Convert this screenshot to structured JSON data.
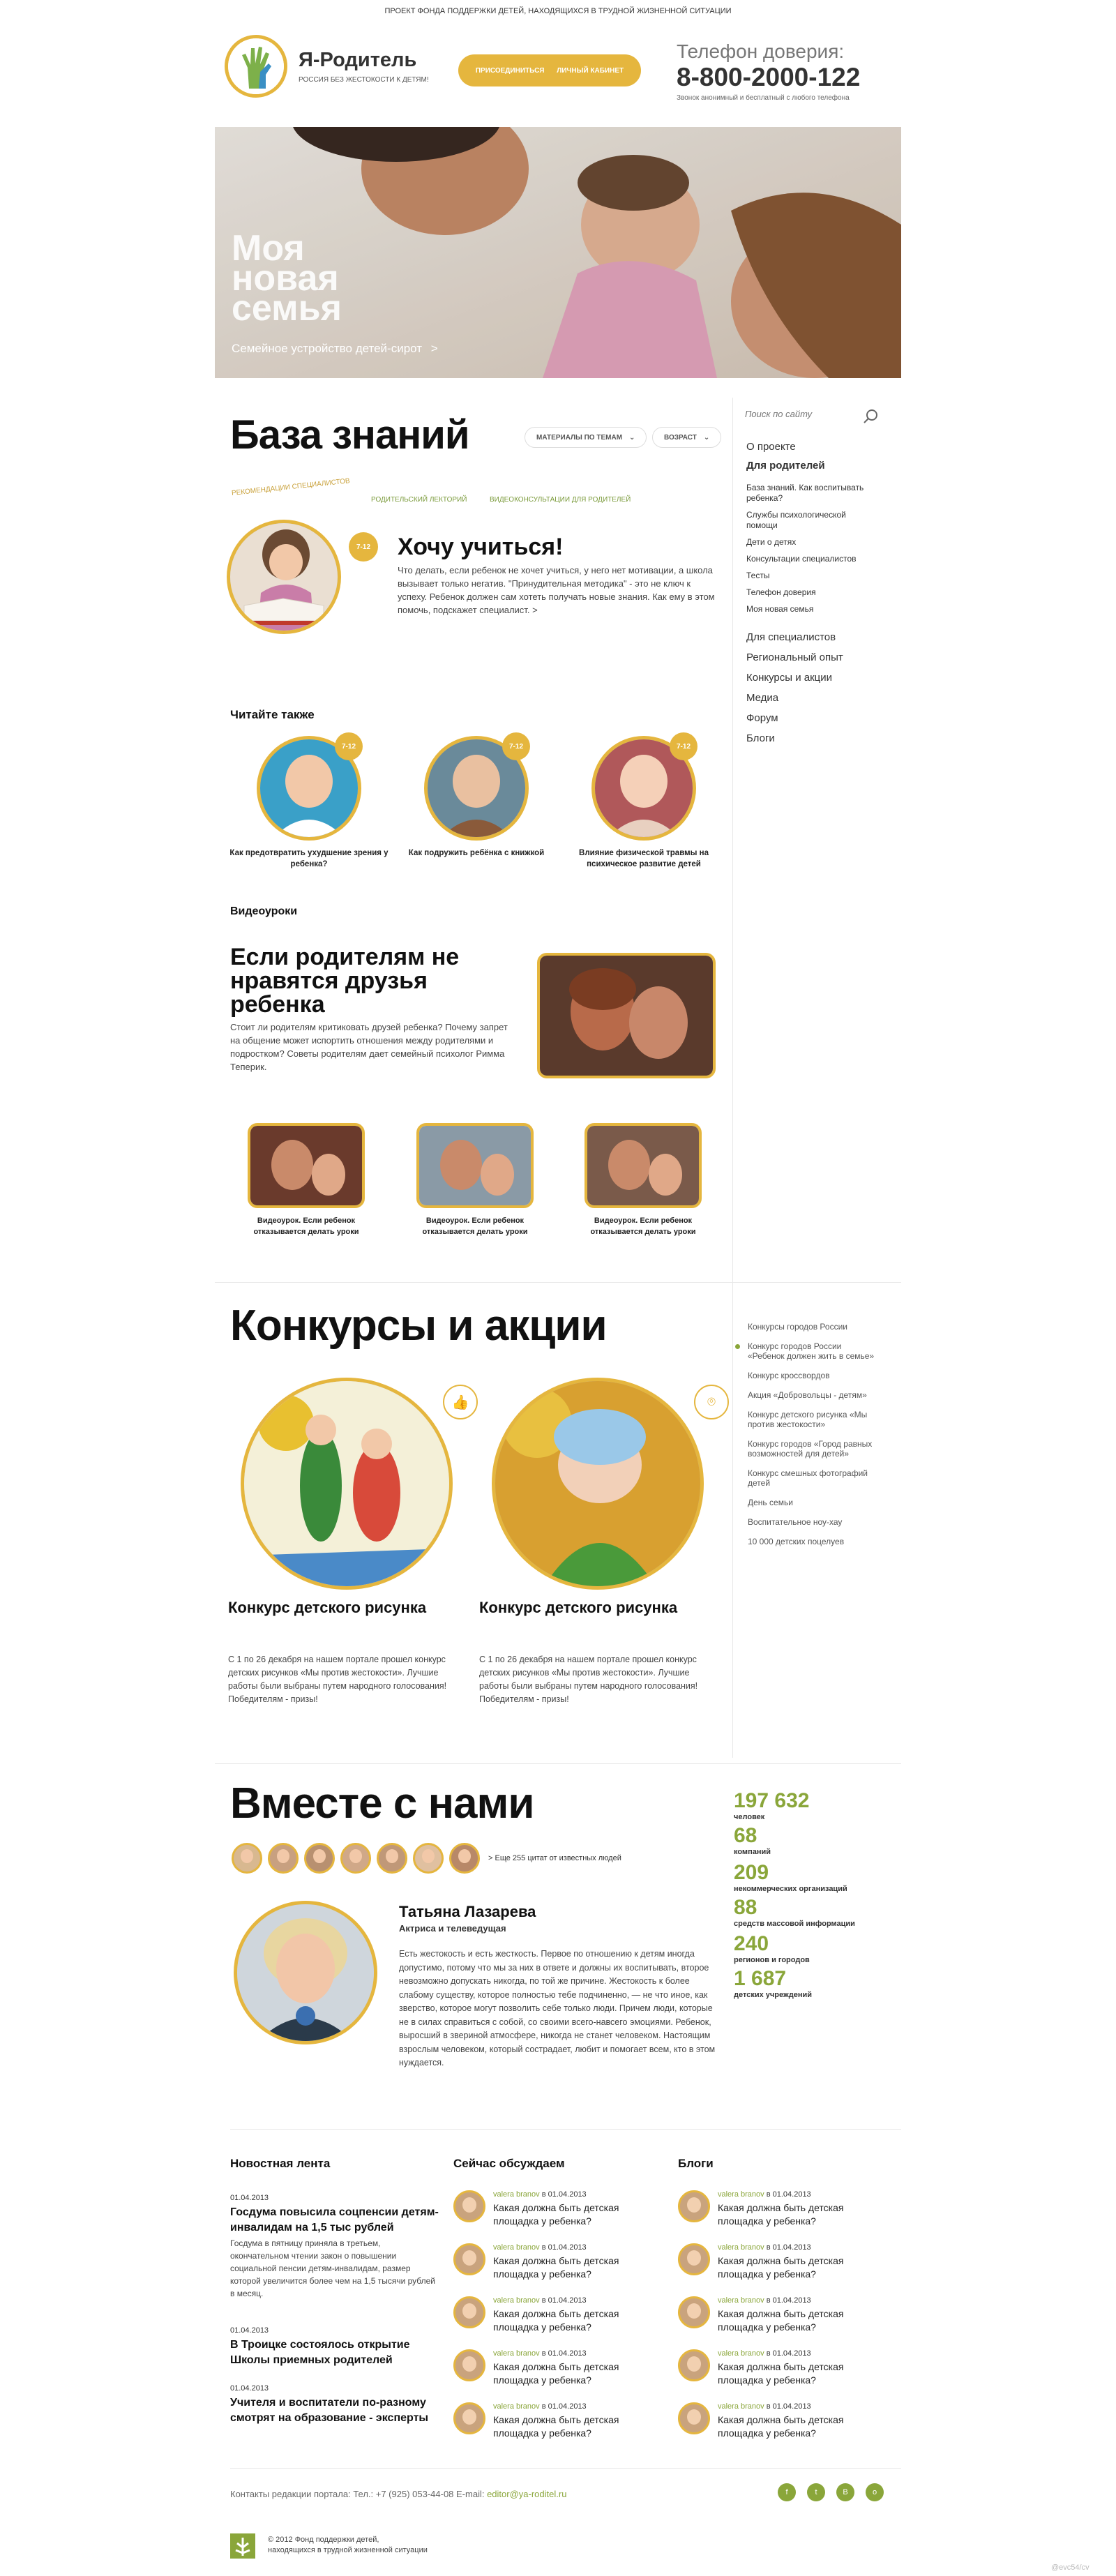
{
  "header": {
    "top_text": "ПРОЕКТ ФОНДА ПОДДЕРЖКИ ДЕТЕЙ, НАХОДЯЩИХСЯ В ТРУДНОЙ ЖИЗНЕННОЙ СИТУАЦИИ",
    "brand": "Я-Родитель",
    "brand_sub": "РОССИЯ БЕЗ ЖЕСТОКОСТИ К ДЕТЯМ!",
    "join_label": "ПРИСОЕДИНИТЬСЯ",
    "cabinet_label": "ЛИЧНЫЙ КАБИНЕТ",
    "hotline_title": "Телефон доверия:",
    "hotline_number": "8-800-2000-122",
    "hotline_note": "Звонок анонимный и бесплатный с любого телефона"
  },
  "hero": {
    "line1": "Моя",
    "line2": "новая",
    "line3": "семья",
    "link": "Семейное устройство детей-сирот",
    "arrow": ">"
  },
  "knowledge": {
    "title": "База знаний",
    "filter_topics": "МАТЕРИАЛЫ ПО ТЕМАМ",
    "filter_age": "ВОЗРАСТ",
    "tabs": [
      "РЕКОМЕНДАЦИИ СПЕЦИАЛИСТОВ",
      "РОДИТЕЛЬСКИЙ ЛЕКТОРИЙ",
      "ВИДЕОКОНСУЛЬТАЦИИ ДЛЯ РОДИТЕЛЕЙ"
    ],
    "featured": {
      "badge": "7-12",
      "title": "Хочу учиться!",
      "text": "Что делать, если ребенок не хочет учиться, у него нет мотивации, а школа вызывает только негатив. \"Принудительная методика\" - это не ключ к успеху. Ребенок должен сам хотеть получать новые знания. Как ему в этом помочь, подскажет специалист.",
      "arrow": ">"
    },
    "see_also_title": "Читайте также",
    "see_also": [
      {
        "badge": "7-12",
        "caption": "Как предотвратить ухудшение зрения у ребенка?"
      },
      {
        "badge": "7-12",
        "caption": "Как подружить ребёнка с книжкой"
      },
      {
        "badge": "7-12",
        "caption": "Влияние физической травмы на психическое развитие детей"
      }
    ],
    "video_title": "Видеоуроки",
    "video_main": {
      "title": "Если родителям не нравятся друзья ребенка",
      "text": "Стоит ли родителям критиковать друзей ребенка? Почему запрет на общение может испортить отношения между родителями и подростком? Советы родителям дает семейный психолог Римма Теперик."
    },
    "videos": [
      {
        "caption": "Видеоурок. Если ребенок отказывается делать уроки"
      },
      {
        "caption": "Видеоурок. Если ребенок отказывается делать уроки"
      },
      {
        "caption": "Видеоурок. Если ребенок отказывается делать уроки"
      }
    ]
  },
  "sidebar": {
    "search_placeholder": "Поиск по сайту",
    "about": "О проекте",
    "parents": "Для родителей",
    "parent_items": [
      "База знаний. Как воспитывать ребенка?",
      "Службы психологической помощи",
      "Дети о детях",
      "Консультации специалистов",
      "Тесты",
      "Телефон доверия",
      "Моя новая семья"
    ],
    "main_items": [
      "Для специалистов",
      "Региональный опыт",
      "Конкурсы и акции",
      "Медиа",
      "Форум",
      "Блоги"
    ],
    "contest_items": [
      "Конкурсы городов России",
      "Конкурс городов России «Ребенок должен жить в семье»",
      "Конкурс кроссвордов",
      "Акция «Добровольцы - детям»",
      "Конкурс детского рисунка «Мы против жестокости»",
      "Конкурс городов «Город равных возможностей для детей»",
      "Конкурс смешных фотографий детей",
      "День семьи",
      "Воспитательное ноу-хау",
      "10 000 детских поцелуев"
    ]
  },
  "contests": {
    "title": "Конкурсы и акции",
    "items": [
      {
        "title": "Конкурс детского рисунка",
        "text": "С 1 по 26 декабря на нашем портале прошел конкурс детских рисунков «Мы против жестокости». Лучшие работы были выбраны путем народного голосования! Победителям - призы!"
      },
      {
        "title": "Конкурс детского рисунка",
        "text": "С 1 по 26 декабря на нашем портале прошел конкурс детских рисунков «Мы против жестокости». Лучшие работы были выбраны путем народного голосования! Победителям - призы!"
      }
    ]
  },
  "together": {
    "title": "Вместе с нами",
    "more_link": "> Еще 255 цитат от известных людей",
    "person_name": "Татьяна Лазарева",
    "person_role": "Актриса и телеведущая",
    "quote": "Есть жестокость и есть жесткость. Первое по отношению к детям иногда допустимо, потому что мы за них в ответе и должны их воспитывать, второе невозможно допускать никогда, по той же причине. Жестокость к более слабому существу, которое полностью тебе подчиненно, — не что иное, как зверство, которое могут позволить себе только люди. Причем люди, которые не в силах справиться с собой, со своими всего-навсего эмоциями. Ребенок, выросший в звериной атмосфере, никогда не станет человеком. Настоящим взрослым человеком, который сострадает, любит и помогает всем, кто в этом нуждается.",
    "stats": [
      {
        "num": "197 632",
        "label": "человек"
      },
      {
        "num": "68",
        "label": "компаний"
      },
      {
        "num": "209",
        "label": "некоммерческих организаций"
      },
      {
        "num": "88",
        "label": "средств массовой информации"
      },
      {
        "num": "240",
        "label": "регионов и городов"
      },
      {
        "num": "1 687",
        "label": "детских учреждений"
      }
    ]
  },
  "news": {
    "title": "Новостная лента",
    "items": [
      {
        "date": "01.04.2013",
        "headline": "Госдума повысила соцпенсии детям-инвалидам на 1,5 тыс рублей",
        "text": "Госдума в пятницу приняла в третьем, окончательном чтении закон о повышении социальной пенсии детям-инвалидам, размер которой увеличится более чем на 1,5 тысячи рублей в месяц."
      },
      {
        "date": "01.04.2013",
        "headline": "В Троицке состоялось открытие Школы приемных родителей",
        "text": ""
      },
      {
        "date": "01.04.2013",
        "headline": "Учителя и воспитатели по-разному смотрят на образование - эксперты",
        "text": ""
      }
    ]
  },
  "discussed": {
    "title": "Сейчас обсуждаем",
    "author": "valera branov",
    "in": " в ",
    "date": "01.04.2013",
    "text": "Какая должна быть детская площадка у ребенка?"
  },
  "blogs": {
    "title": "Блоги",
    "author": "valera branov",
    "in": " в ",
    "date": "01.04.2013",
    "text": "Какая должна быть детская площадка у ребенка?"
  },
  "footer": {
    "contacts": "Контакты редакции портала: Тел.: +7 (925) 053-44-08 E-mail: ",
    "email": "editor@ya-roditel.ru",
    "copyright_line1": "© 2012 Фонд поддержки детей,",
    "copyright_line2": "находящихся в трудной жизненной ситуации",
    "credit": "@evc54/cv"
  },
  "colors": {
    "accent": "#e5b63e",
    "green": "#8aa63a"
  }
}
